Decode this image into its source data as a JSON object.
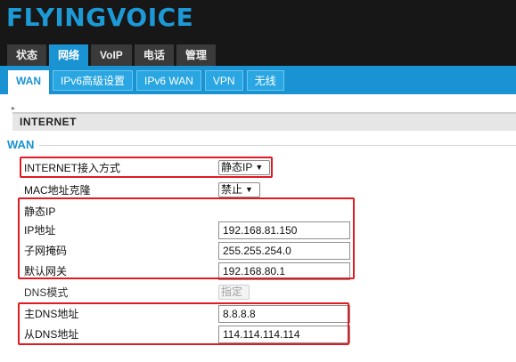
{
  "brand": {
    "logo_text": "FLYINGVOICE"
  },
  "main_tabs": [
    "状态",
    "网络",
    "VoIP",
    "电话",
    "管理"
  ],
  "sub_tabs": [
    "WAN",
    "IPv6高级设置",
    "IPv6 WAN",
    "VPN",
    "无线"
  ],
  "section": {
    "title": "INTERNET",
    "corner_mark": "▸"
  },
  "wan": {
    "legend": "WAN",
    "connection_type": {
      "label": "INTERNET接入方式",
      "value": "静态IP"
    },
    "mac_clone": {
      "label": "MAC地址克隆",
      "value": "禁止"
    },
    "static_ip": {
      "heading": "静态IP",
      "ip": {
        "label": "IP地址",
        "value": "192.168.81.150"
      },
      "mask": {
        "label": "子网掩码",
        "value": "255.255.254.0"
      },
      "gateway": {
        "label": "默认网关",
        "value": "192.168.80.1"
      }
    },
    "dns_mode": {
      "label": "DNS模式",
      "value": "指定"
    },
    "primary_dns": {
      "label": "主DNS地址",
      "value": "8.8.8.8"
    },
    "secondary_dns": {
      "label": "从DNS地址",
      "value": "114.114.114.114"
    }
  },
  "colors": {
    "brand_blue": "#1a93d3",
    "highlight_red": "#e11b22",
    "header_bg": "#171717"
  }
}
